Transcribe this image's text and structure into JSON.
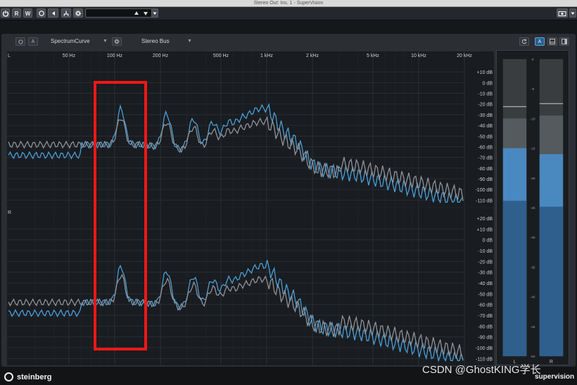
{
  "window": {
    "title": "Stereo Out: Ins. 1 - SuperVision"
  },
  "toolbar": {
    "r_label": "R",
    "w_label": "W"
  },
  "panel": {
    "module_name": "SpectrumCurve",
    "source": "Stereo Bus",
    "a_label": "A"
  },
  "spectrum": {
    "freq_labels": [
      {
        "text": "50 Hz",
        "hz": 50
      },
      {
        "text": "100 Hz",
        "hz": 100
      },
      {
        "text": "200 Hz",
        "hz": 200
      },
      {
        "text": "500 Hz",
        "hz": 500
      },
      {
        "text": "1 kHz",
        "hz": 1000
      },
      {
        "text": "2 kHz",
        "hz": 2000
      },
      {
        "text": "5 kHz",
        "hz": 5000
      },
      {
        "text": "10 kHz",
        "hz": 10000
      },
      {
        "text": "20 kHz",
        "hz": 20000
      }
    ],
    "db_labels": [
      "+10 dB",
      "0 dB",
      "-10 dB",
      "-20 dB",
      "-30 dB",
      "-40 dB",
      "-50 dB",
      "-60 dB",
      "-70 dB",
      "-80 dB",
      "-90 dB",
      "-100 dB",
      "-110 dB"
    ],
    "top_db_label": "+20 dB",
    "channels": [
      {
        "letter": "L",
        "db_range": [
          -115,
          20
        ]
      },
      {
        "letter": "R",
        "db_range": [
          -115,
          20
        ]
      }
    ],
    "curves": [
      {
        "color": "#4a9ed8",
        "kind": "live"
      },
      {
        "color": "#8f9296",
        "kind": "hold"
      }
    ]
  },
  "meters": {
    "scale": [
      "0",
      "-5",
      "-10",
      "-15",
      "-20",
      "-25",
      "-30",
      "-35",
      "-40",
      "-45",
      "-50"
    ],
    "channels": [
      {
        "letter": "L",
        "peak_db": -10,
        "rms_db": -15,
        "hold_db": -8
      },
      {
        "letter": "R",
        "peak_db": -9.5,
        "rms_db": -16,
        "hold_db": -7.5
      }
    ]
  },
  "footer": {
    "brand": "steinberg",
    "product": "supervision"
  },
  "watermark": "CSDN @GhostKING学长",
  "colors": {
    "accent": "#4a9ed8",
    "highlight": "#f01717",
    "panel": "#2b2e33"
  }
}
